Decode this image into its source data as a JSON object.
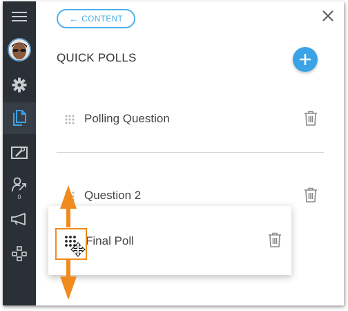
{
  "sidebar": {
    "badge_count": "0",
    "items": [
      {
        "name": "menu-icon"
      },
      {
        "name": "avatar"
      },
      {
        "name": "gear-icon"
      },
      {
        "name": "content-icon",
        "active": true
      },
      {
        "name": "whiteboard-icon"
      },
      {
        "name": "user-share-icon"
      },
      {
        "name": "megaphone-icon"
      },
      {
        "name": "network-icon"
      }
    ]
  },
  "header": {
    "back_label": "CONTENT",
    "close_icon": "close-icon"
  },
  "main": {
    "title": "QUICK POLLS",
    "add_icon": "plus-icon",
    "polls": [
      {
        "label": "Polling Question"
      },
      {
        "label": "Question 2"
      },
      {
        "label": "Final Poll",
        "dragging": true
      }
    ]
  },
  "colors": {
    "accent": "#3aa3e6",
    "sidebar": "#2a3036",
    "drag_highlight": "#f08a1c"
  }
}
